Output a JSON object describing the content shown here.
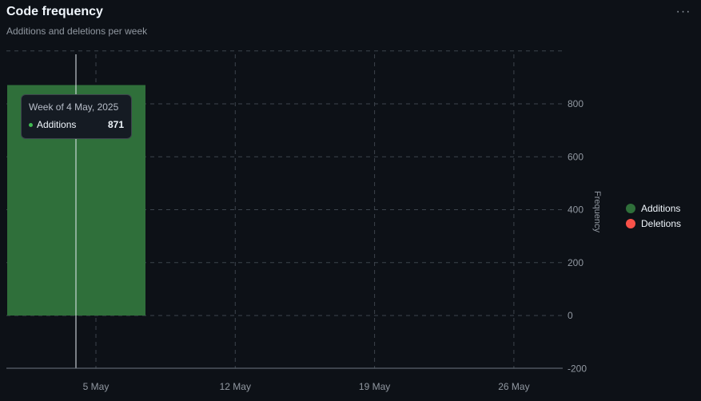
{
  "header": {
    "title": "Code frequency",
    "subtitle": "Additions and deletions per week",
    "menu_glyph": "···"
  },
  "chart_data": {
    "type": "bar",
    "x_ticks": [
      "5 May",
      "12 May",
      "19 May",
      "26 May"
    ],
    "series": [
      {
        "name": "Additions",
        "color": "#2f6f3a",
        "values": [
          {
            "week": "4 May, 2025",
            "value": 871
          }
        ]
      },
      {
        "name": "Deletions",
        "color": "#f85149",
        "values": []
      }
    ],
    "ylabel": "Frequency",
    "y_ticks": [
      -200,
      0,
      200,
      400,
      600,
      800
    ],
    "ylim": [
      -200,
      1000
    ],
    "grid": true,
    "legend_position": "right"
  },
  "tooltip": {
    "title": "Week of 4 May, 2025",
    "series": "Additions",
    "value": "871"
  }
}
